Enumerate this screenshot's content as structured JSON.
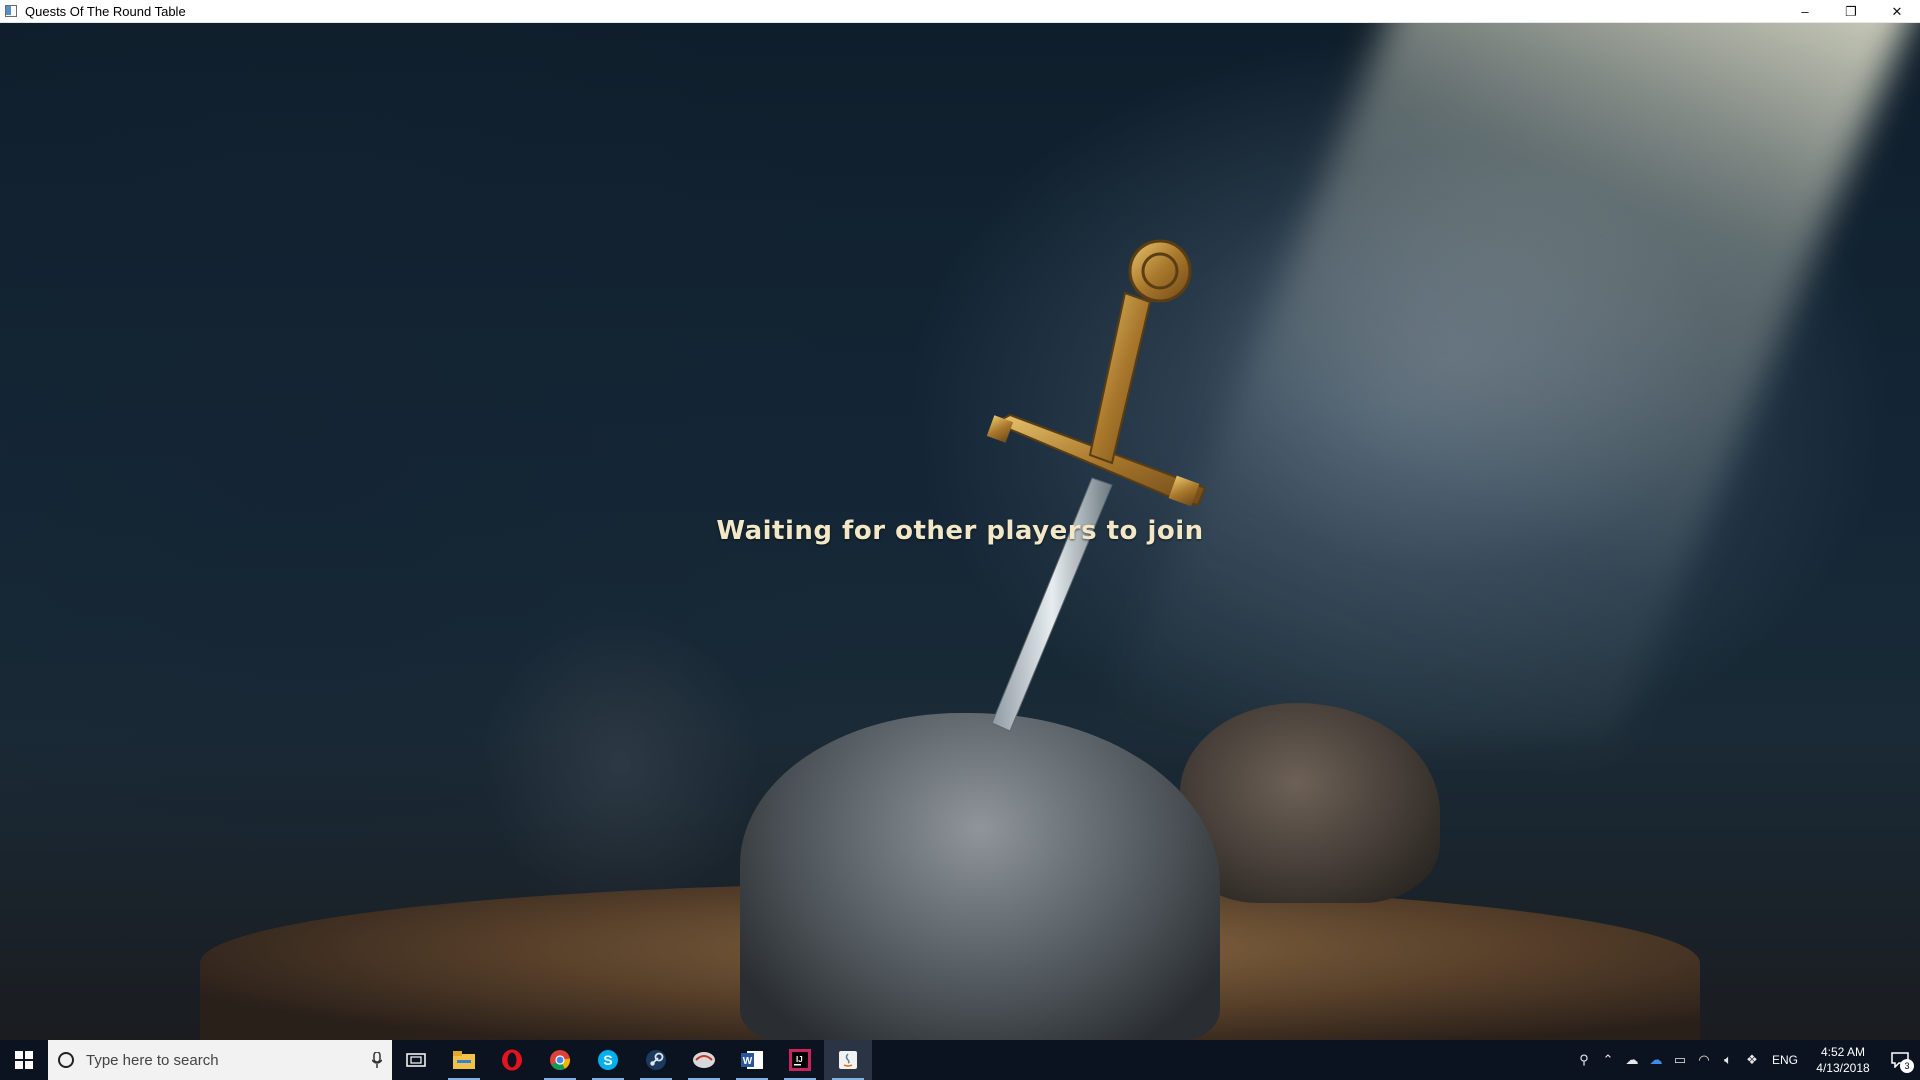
{
  "window": {
    "title": "Quests Of The Round Table",
    "controls": {
      "minimize": "–",
      "restore": "❐",
      "close": "✕"
    }
  },
  "game": {
    "status_message": "Waiting for other players to join"
  },
  "taskbar": {
    "search_placeholder": "Type here to search",
    "apps": [
      {
        "name": "task-view-icon"
      },
      {
        "name": "file-explorer-icon"
      },
      {
        "name": "opera-icon"
      },
      {
        "name": "chrome-icon"
      },
      {
        "name": "skype-icon"
      },
      {
        "name": "steam-icon"
      },
      {
        "name": "game-launcher-icon"
      },
      {
        "name": "word-icon"
      },
      {
        "name": "intellij-icon"
      },
      {
        "name": "java-icon"
      }
    ],
    "tray": {
      "language": "ENG",
      "time": "4:52 AM",
      "date": "4/13/2018",
      "notification_count": "3"
    }
  },
  "colors": {
    "taskbar_bg": "#0b1220",
    "status_text": "#f2e8c8",
    "accent": "#7fb2e6"
  }
}
